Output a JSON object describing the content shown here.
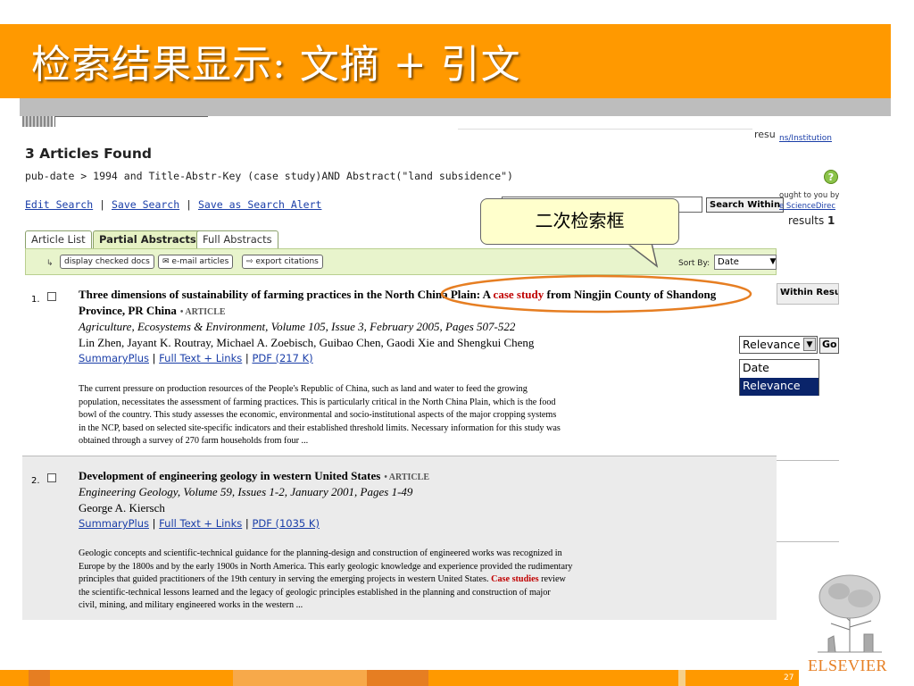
{
  "slide": {
    "title": "检索结果显示: 文摘 + 引文",
    "page_number": "27",
    "publisher": "ELSEVIER",
    "callout_text": "二次检索框",
    "accent_color": "#FF9900"
  },
  "header": {
    "resu_text": "resu",
    "institution_link": "ns/Institution",
    "articles_found": "3 Articles Found",
    "query": "pub-date > 1994 and Title-Abstr-Key (case study)AND Abstract(\"land subsidence\")",
    "edit_search": "Edit Search",
    "save_search": "Save Search",
    "save_alert": "Save as Search Alert",
    "sep": "|",
    "search_within_button": "Search Within",
    "brought_text": "ought to you by",
    "sd_link": "e ScienceDirec",
    "results_label": "results",
    "results_value": "1",
    "help_icon": "?"
  },
  "tabs": [
    {
      "label": "Article List",
      "active": false
    },
    {
      "label": "Partial Abstracts",
      "active": true
    },
    {
      "label": "Full Abstracts",
      "active": false
    }
  ],
  "toolbar": {
    "display_checked": "display checked docs",
    "email_articles": "e-mail articles",
    "export_citations": "export citations",
    "sort_by_label": "Sort By:",
    "sort_value": "Date"
  },
  "results": [
    {
      "number": "1.",
      "title_pre": "Three dimensions of sustainability of farming practices in the North China Plain: A ",
      "title_hl": "case study",
      "title_post": " from Ningjin County of Shandong",
      "title_line2": "Province, PR China",
      "type": "• ARTICLE",
      "source": "Agriculture, Ecosystems & Environment, Volume 105, Issue 3, February 2005, Pages 507-522",
      "authors": "Lin Zhen, Jayant K. Routray, Michael A. Zoebisch, Guibao Chen, Gaodi Xie and Shengkui Cheng",
      "link1": "SummaryPlus",
      "link2": "Full Text + Links",
      "link3": "PDF (217 K)",
      "abstract_lines": [
        "The current pressure on production resources of the People's Republic of China, such as land and water to feed the growing",
        "population, necessitates the assessment of farming practices. This is particularly critical in the North China Plain, which is the food",
        "bowl of the country. This study assesses the economic, environmental and socio-institutional aspects of the major cropping systems",
        "in the NCP, based on selected site-specific indicators and their established threshold limits. Necessary information for this study was",
        "obtained through a survey of 270 farm households from four ..."
      ]
    },
    {
      "number": "2.",
      "title": "Development of engineering geology in western United States",
      "type": "• ARTICLE",
      "source": "Engineering Geology, Volume 59, Issues 1-2, January 2001, Pages 1-49",
      "authors": "George A. Kiersch",
      "link1": "SummaryPlus",
      "link2": "Full Text + Links",
      "link3": "PDF (1035 K)",
      "abstract_lines": [
        "Geologic concepts and scientific-technical guidance for the planning-design and construction of engineered works was recognized in",
        "Europe by the 1800s and by the early 1900s in North America. This early geologic knowledge and experience provided the rudimentary",
        "the scientific-technical lessons learned and the legacy of geologic principles established in the planning and construction of major",
        "civil, mining, and military engineered works in the western ..."
      ],
      "abstract_line3_pre": "principles that guided practitioners of the 19th century in serving the emerging projects in western United States. ",
      "abstract_line3_hl": "Case studies",
      "abstract_line3_post": " review"
    }
  ],
  "overlay": {
    "within_results": "Within Resu",
    "relevance_selected": "Relevance",
    "go_button": "Go",
    "options": [
      "Date",
      "Relevance"
    ]
  }
}
